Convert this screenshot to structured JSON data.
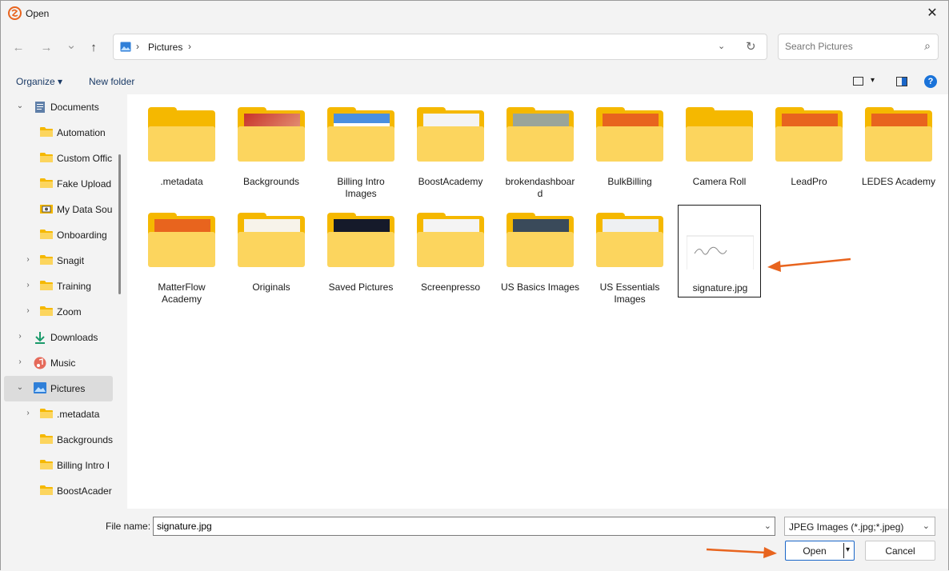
{
  "window": {
    "title": "Open",
    "close_glyph": "✕"
  },
  "nav": {
    "back_glyph": "←",
    "forward_glyph": "→",
    "recent_glyph": "⌄",
    "up_glyph": "↑"
  },
  "address": {
    "crumbs": [
      "Pictures"
    ],
    "separator": "›",
    "dropdown_glyph": "⌄",
    "refresh_glyph": "↻"
  },
  "search": {
    "placeholder": "Search Pictures",
    "icon_glyph": "⌕"
  },
  "toolbar": {
    "organize_label": "Organize ▾",
    "new_folder_label": "New folder",
    "view_dropdown_glyph": "▾",
    "help_glyph": "?"
  },
  "sidebar": {
    "items": [
      {
        "label": "Documents",
        "icon": "documents-icon",
        "expand": "⌄"
      },
      {
        "label": "Automation",
        "icon": "folder-icon",
        "expand": ""
      },
      {
        "label": "Custom Offic",
        "icon": "folder-icon",
        "expand": ""
      },
      {
        "label": "Fake Upload",
        "icon": "folder-icon",
        "expand": ""
      },
      {
        "label": "My Data Sou",
        "icon": "data-source-icon",
        "expand": ""
      },
      {
        "label": "Onboarding",
        "icon": "folder-icon",
        "expand": ""
      },
      {
        "label": "Snagit",
        "icon": "folder-icon",
        "expand": "›"
      },
      {
        "label": "Training",
        "icon": "folder-icon",
        "expand": "›"
      },
      {
        "label": "Zoom",
        "icon": "folder-icon",
        "expand": "›"
      },
      {
        "label": "Downloads",
        "icon": "download-icon",
        "expand": "›"
      },
      {
        "label": "Music",
        "icon": "music-icon",
        "expand": "›"
      },
      {
        "label": "Pictures",
        "icon": "pictures-icon",
        "expand": "⌄"
      },
      {
        "label": ".metadata",
        "icon": "folder-icon",
        "expand": "›"
      },
      {
        "label": "Backgrounds",
        "icon": "folder-icon",
        "expand": ""
      },
      {
        "label": "Billing Intro I",
        "icon": "folder-icon",
        "expand": ""
      },
      {
        "label": "BoostAcader",
        "icon": "folder-icon",
        "expand": ""
      }
    ]
  },
  "files": [
    {
      "name": ".metadata",
      "kind": "folder"
    },
    {
      "name": "Backgrounds",
      "kind": "folder"
    },
    {
      "name": "Billing Intro\nImages",
      "kind": "folder"
    },
    {
      "name": "BoostAcademy",
      "kind": "folder"
    },
    {
      "name": "brokendashboar\nd",
      "kind": "folder"
    },
    {
      "name": "BulkBilling",
      "kind": "folder"
    },
    {
      "name": "Camera Roll",
      "kind": "folder"
    },
    {
      "name": "LeadPro",
      "kind": "folder"
    },
    {
      "name": "LEDES Academy",
      "kind": "folder"
    },
    {
      "name": "MatterFlow\nAcademy",
      "kind": "folder"
    },
    {
      "name": "Originals",
      "kind": "folder"
    },
    {
      "name": "Saved Pictures",
      "kind": "folder"
    },
    {
      "name": "Screenpresso",
      "kind": "folder"
    },
    {
      "name": "US Basics Images",
      "kind": "folder"
    },
    {
      "name": "US Essentials\nImages",
      "kind": "folder"
    },
    {
      "name": "signature.jpg",
      "kind": "image"
    }
  ],
  "bottom": {
    "file_name_label": "File name:",
    "file_name_value": "signature.jpg",
    "file_type_label": "JPEG Images (*.jpg;*.jpeg)",
    "dropdown_glyph": "⌄",
    "open_label": "Open",
    "open_split_glyph": "▾",
    "cancel_label": "Cancel"
  },
  "colors": {
    "folder": "#f5b800",
    "folder_front": "#fcd55e",
    "accent": "#1a66c8",
    "annotation_arrow": "#e8641e"
  }
}
